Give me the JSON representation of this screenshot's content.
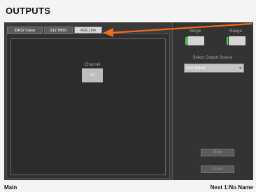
{
  "header": {
    "title": "OUTPUTS"
  },
  "tabs": [
    {
      "label": "iDR32 Carey",
      "active": false
    },
    {
      "label": "I112 TMD1",
      "active": false
    },
    {
      "label": "ACE Link",
      "active": true
    }
  ],
  "channel": {
    "label": "Channel",
    "value": "33"
  },
  "right_panel": {
    "single_label": "Single",
    "range_label": "Range",
    "single_active": true,
    "range_active": true,
    "source_label": "Select Output Source",
    "source_value": "Not Patched",
    "apply_label": "Apply",
    "cancel_label": "Cancel"
  },
  "footer": {
    "left": "Main",
    "right": "Next 1:No Name"
  },
  "colors": {
    "accent_arrow": "#f26a1b",
    "led_green": "#2ef02e"
  }
}
